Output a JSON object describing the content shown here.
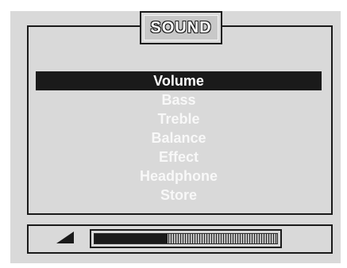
{
  "menu": {
    "title": "SOUND",
    "selected_index": 0,
    "items": [
      "Volume",
      "Bass",
      "Treble",
      "Balance",
      "Effect",
      "Headphone",
      "Store"
    ]
  },
  "volume": {
    "icon": "volume-ramp-icon",
    "level_fraction": 0.4
  },
  "colors": {
    "background": "#d9d9d9",
    "highlight": "#1a1a1a",
    "text": "#f8f8f8"
  }
}
